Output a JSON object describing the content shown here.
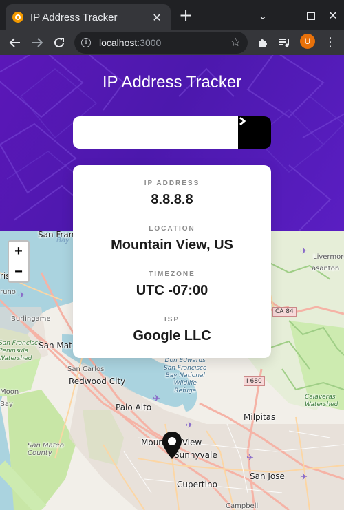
{
  "browser": {
    "tab_title": "IP Address Tracker",
    "tab_close": "✕",
    "new_tab": "+",
    "url_host": "localhost",
    "url_port": ":3000",
    "profile_initial": "U"
  },
  "app": {
    "title": "IP Address Tracker",
    "search_placeholder": "",
    "search_value": ""
  },
  "info": {
    "ip_label": "IP ADDRESS",
    "ip_value": "8.8.8.8",
    "location_label": "LOCATION",
    "location_value": "Mountain View, US",
    "timezone_label": "TIMEZONE",
    "timezone_value": "UTC -07:00",
    "isp_label": "ISP",
    "isp_value": "Google LLC"
  },
  "map": {
    "zoom_in": "+",
    "zoom_out": "−",
    "labels": {
      "san_francisco": "San Francisco",
      "bay": "Bay",
      "brisco": "risco",
      "runo": "runo",
      "burlingame": "Burlingame",
      "sf_peninsula": "San Francisco\nPeninsula\nWatershed",
      "san_mateo": "San Mat",
      "san_carlos": "San Carlos",
      "redwood_city": "Redwood City",
      "moon": "Moon",
      "bay_left": "Bay",
      "palo_alto": "Palo Alto",
      "don_edwards": "Don Edwards\nSan Francisco\nBay National\nWildlife\nRefuge",
      "milpitas": "Milpitas",
      "mountain_view": "Mountain View",
      "sunnyvale": "Sunnyvale",
      "san_mateo_county": "San Mateo\nCounty",
      "san_jose": "San Jose",
      "cupertino": "Cupertino",
      "campbell": "Campbell",
      "livermore": "Livermore",
      "pleasanton": "asanton",
      "calaveras": "Calaveras\nWatershed",
      "ca84": "CA 84",
      "i680": "I 680"
    }
  }
}
